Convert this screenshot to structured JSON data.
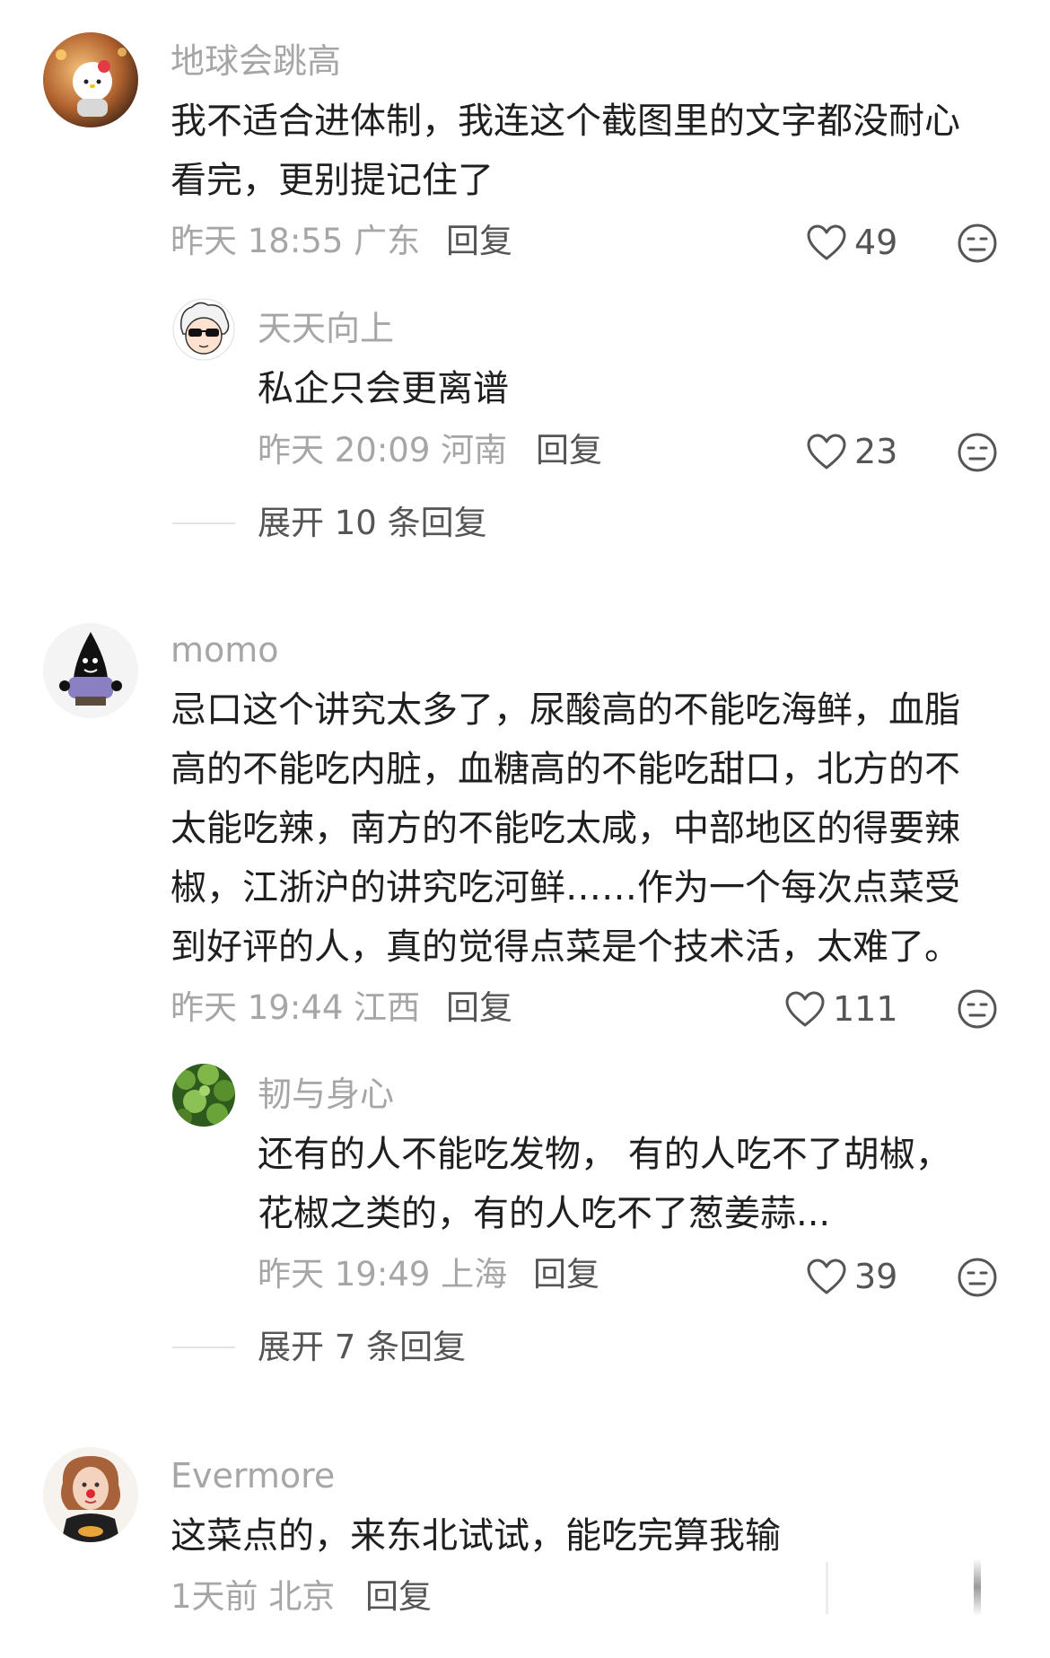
{
  "comments": [
    {
      "user": "地球会跳高",
      "text_lines": [
        "我不适合进体制，我连这个截图里的文字都没耐心",
        "看完，更别提记住了"
      ],
      "time": "昨天 18:55",
      "location": "广东",
      "reply_label": "回复",
      "likes": "49",
      "replies": [
        {
          "user": "天天向上",
          "text_lines": [
            "私企只会更离谱"
          ],
          "time": "昨天 20:09",
          "location": "河南",
          "reply_label": "回复",
          "likes": "23"
        }
      ],
      "expand_label": "展开 10 条回复"
    },
    {
      "user": "momo",
      "text_lines": [
        "忌口这个讲究太多了，尿酸高的不能吃海鲜，血脂",
        "高的不能吃内脏，血糖高的不能吃甜口，北方的不",
        "太能吃辣，南方的不能吃太咸，中部地区的得要辣",
        "椒，江浙沪的讲究吃河鲜……作为一个每次点菜受",
        "到好评的人，真的觉得点菜是个技术活，太难了。"
      ],
      "time": "昨天 19:44",
      "location": "江西",
      "reply_label": "回复",
      "likes": "111",
      "replies": [
        {
          "user": "韧与身心",
          "text_lines": [
            "还有的人不能吃发物， 有的人吃不了胡椒，",
            "花椒之类的，有的人吃不了葱姜蒜..."
          ],
          "time": "昨天 19:49",
          "location": "上海",
          "reply_label": "回复",
          "likes": "39"
        }
      ],
      "expand_label": "展开 7 条回复"
    },
    {
      "user": "Evermore",
      "text_lines": [
        "这菜点的，来东北试试，能吃完算我输"
      ],
      "time": "1天前",
      "location": "北京",
      "reply_label": "回复",
      "likes": ""
    }
  ],
  "icons": {
    "like": "heart-outline-icon",
    "dislike": "unamused-face-icon"
  },
  "colors": {
    "username": "#a6a6a6",
    "body_text": "#1f1f1f",
    "meta": "#a6a6a6",
    "action": "#555555"
  }
}
